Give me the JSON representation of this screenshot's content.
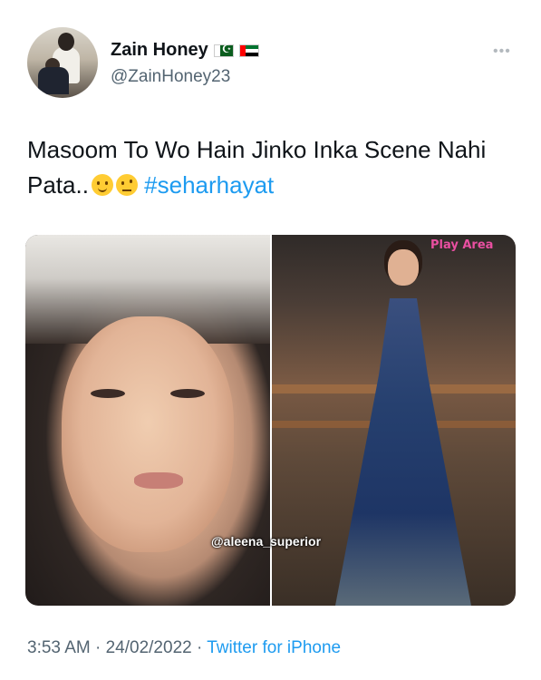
{
  "user": {
    "display_name": "Zain Honey",
    "handle": "@ZainHoney23",
    "flags": [
      "pakistan-flag-icon",
      "uae-flag-icon"
    ]
  },
  "more_icon": "more-horizontal-icon",
  "tweet": {
    "text": "Masoom To Wo Hain Jinko Inka Scene Nahi Pata..",
    "emojis": [
      "slightly-smiling-face-icon",
      "face-with-raised-eyebrow-icon"
    ],
    "hashtag": "#seharhayat"
  },
  "media": {
    "watermark": "@aleena_superior",
    "sign_text": "Play Area"
  },
  "meta": {
    "time": "3:53 AM",
    "separator1": " · ",
    "date": "24/02/2022",
    "separator2": " · ",
    "source": "Twitter for iPhone"
  },
  "colors": {
    "link": "#1d9bf0",
    "secondary_text": "#536471",
    "primary_text": "#0f1419"
  }
}
